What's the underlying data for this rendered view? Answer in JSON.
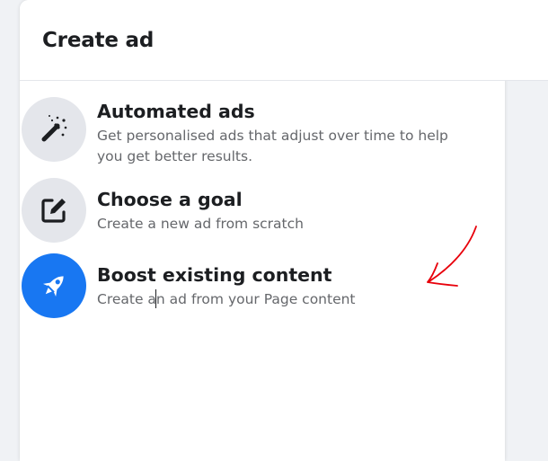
{
  "dialog": {
    "title": "Create ad"
  },
  "options": [
    {
      "title": "Automated ads",
      "description": "Get personalised ads that adjust over time to help you get better results.",
      "icon": "magic-wand-icon"
    },
    {
      "title": "Choose a goal",
      "description": "Create a new ad from scratch",
      "icon": "edit-icon"
    },
    {
      "title": "Boost existing content",
      "description": "Create an ad from your Page content",
      "icon": "rocket-icon"
    }
  ],
  "colors": {
    "accent": "#1877f2",
    "icon_bg": "#e4e6eb",
    "annotation": "#e8000b"
  }
}
